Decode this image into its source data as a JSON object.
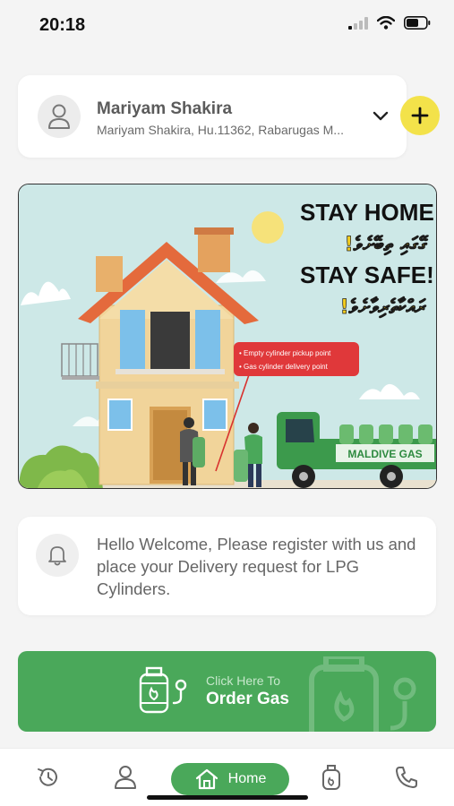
{
  "status_bar": {
    "time": "20:18"
  },
  "profile": {
    "name": "Mariyam Shakira",
    "address": "Mariyam Shakira, Hu.11362, Rabarugas M..."
  },
  "banner": {
    "headline_1": "STAY HOME!",
    "headline_2": "STAY SAFE!",
    "dhivehi_1": "!ގޭގައި ތިބޭށެވެ",
    "dhivehi_2": "!ރައްކާތެރިވާށެވެ",
    "legend_1": "• Empty cylinder pickup point",
    "legend_2": "• Gas cylinder delivery point",
    "truck_label": "MALDIVE GAS"
  },
  "message": {
    "text": "Hello Welcome, Please register with us and place your Delivery request for LPG Cylinders."
  },
  "order": {
    "subtitle": "Click Here To",
    "title": "Order Gas"
  },
  "tab_bar": {
    "active": "home",
    "home_label": "Home",
    "tabs": [
      "history",
      "profile",
      "home",
      "cylinder",
      "phone"
    ]
  },
  "colors": {
    "primary_green": "#4aa85a",
    "accent_yellow": "#f3e24a",
    "background": "#f4f4f4"
  }
}
